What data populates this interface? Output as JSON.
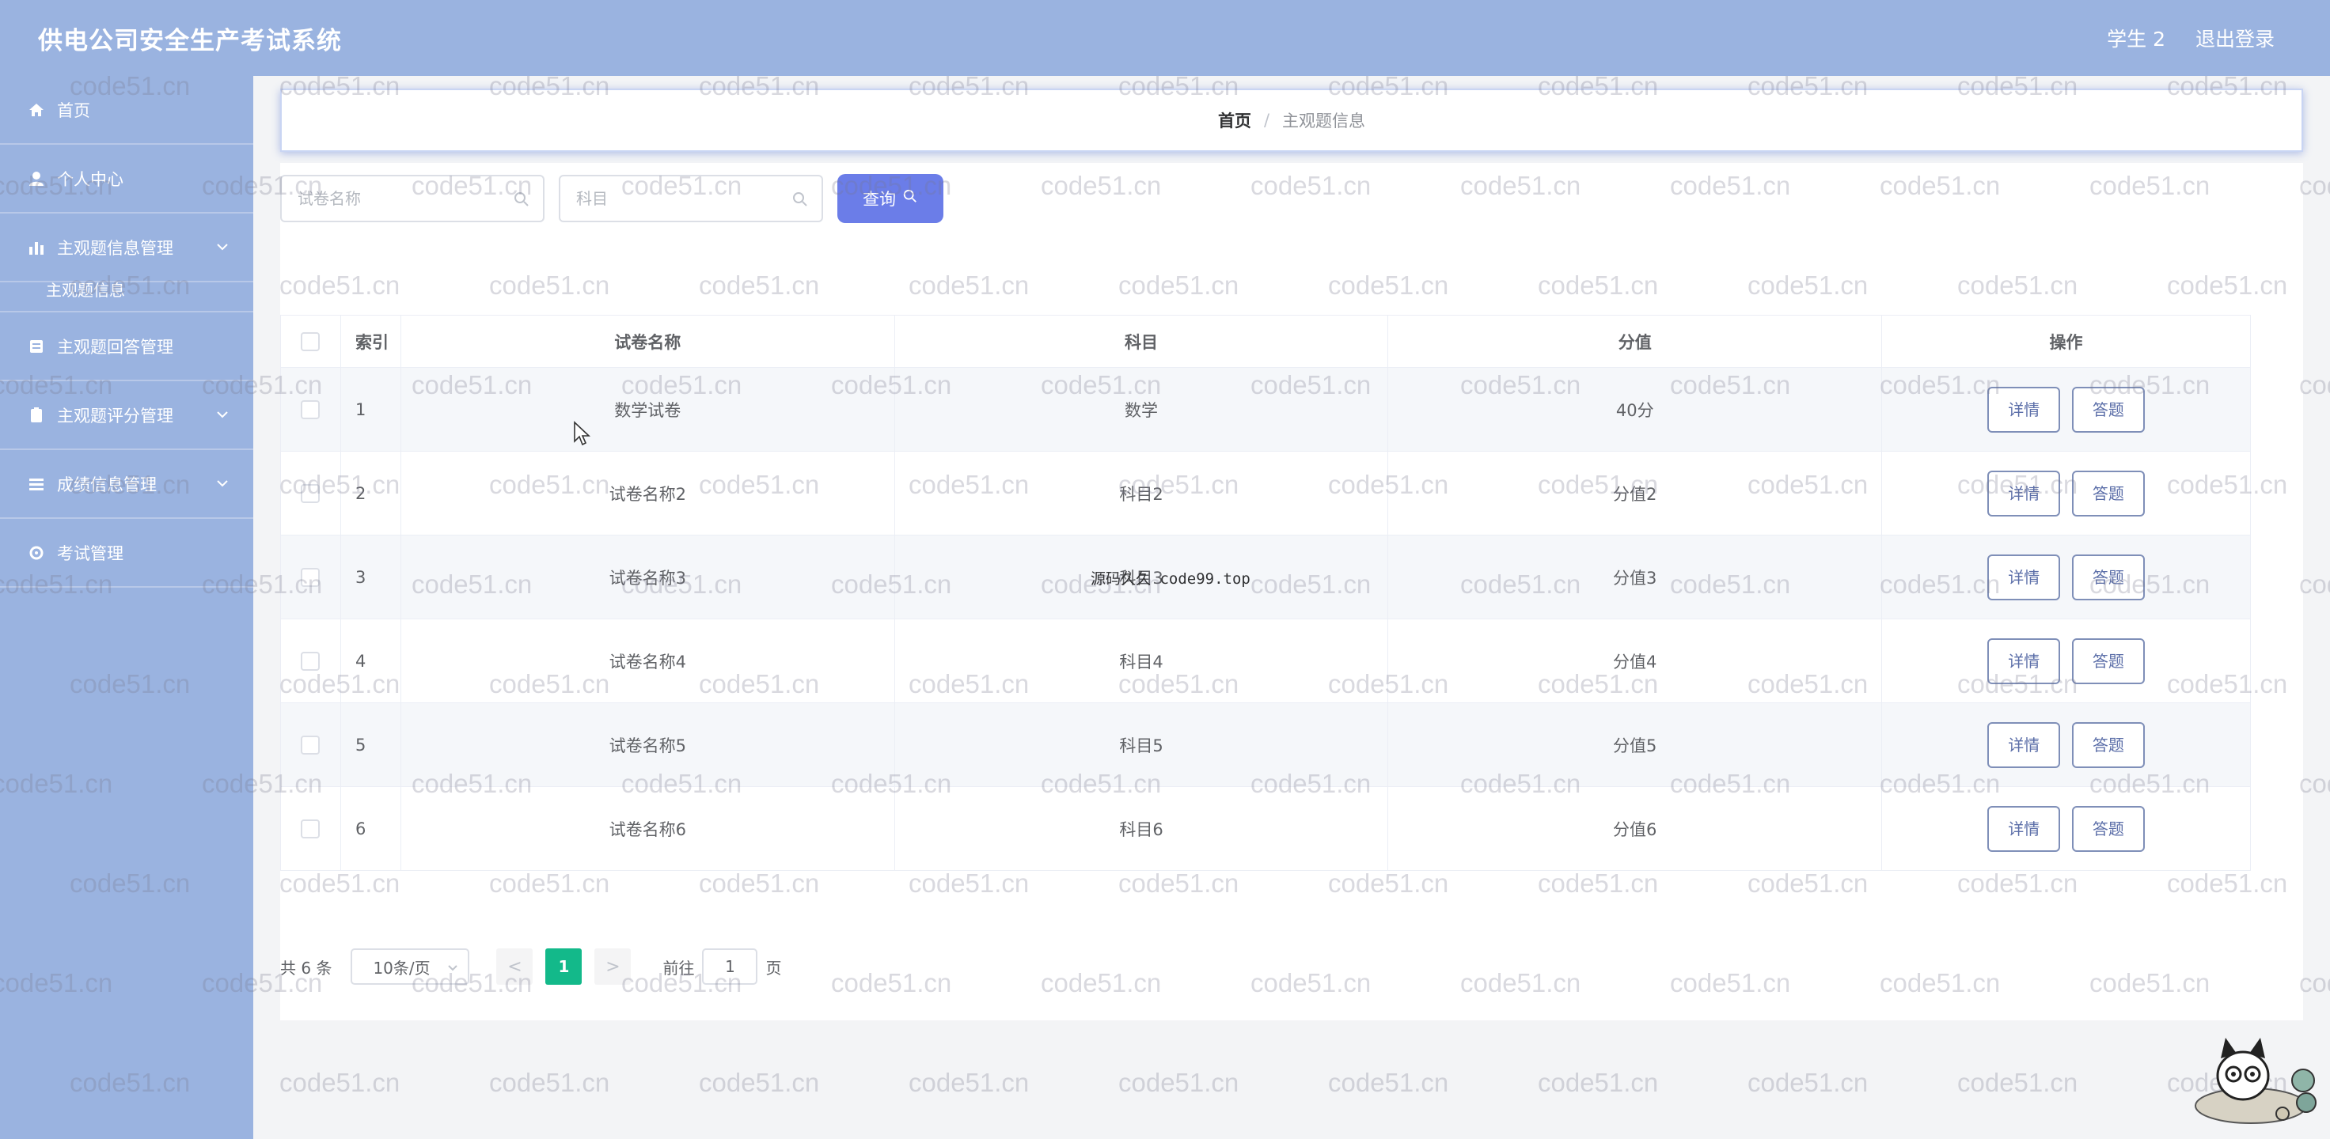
{
  "header": {
    "title": "供电公司安全生产考试系统",
    "user": "学生 2",
    "logout": "退出登录"
  },
  "sidebar": {
    "items": [
      {
        "label": "首页",
        "icon": "home-icon"
      },
      {
        "label": "个人中心",
        "icon": "user-icon"
      },
      {
        "label": "主观题信息管理",
        "icon": "bar-chart-icon"
      },
      {
        "label": "主观题回答管理",
        "icon": "document-icon"
      },
      {
        "label": "主观题评分管理",
        "icon": "clipboard-icon"
      },
      {
        "label": "成绩信息管理",
        "icon": "menu-icon"
      },
      {
        "label": "考试管理",
        "icon": "settings-icon"
      }
    ],
    "sub_item": "主观题信息"
  },
  "breadcrumb": {
    "home": "首页",
    "separator": "/",
    "current": "主观题信息"
  },
  "search": {
    "paper_placeholder": "试卷名称",
    "subject_placeholder": "科目",
    "query_label": "查询"
  },
  "table": {
    "headers": {
      "index": "索引",
      "name": "试卷名称",
      "subject": "科目",
      "score": "分值",
      "ops": "操作"
    },
    "rows": [
      {
        "index": "1",
        "name": "数学试卷",
        "subject": "数学",
        "score": "40分"
      },
      {
        "index": "2",
        "name": "试卷名称2",
        "subject": "科目2",
        "score": "分值2"
      },
      {
        "index": "3",
        "name": "试卷名称3",
        "subject": "科目3",
        "score": "分值3"
      },
      {
        "index": "4",
        "name": "试卷名称4",
        "subject": "科目4",
        "score": "分值4"
      },
      {
        "index": "5",
        "name": "试卷名称5",
        "subject": "科目5",
        "score": "分值5"
      },
      {
        "index": "6",
        "name": "试卷名称6",
        "subject": "科目6",
        "score": "分值6"
      }
    ],
    "detail_label": "详情",
    "answer_label": "答题"
  },
  "pagination": {
    "total": "共 6 条",
    "page_size": "10条/页",
    "prev": "<",
    "current_page": "1",
    "next": ">",
    "goto_label": "前往",
    "goto_value": "1",
    "page_suffix": "页"
  },
  "watermark": "code51.cn",
  "overlay_text": "源码久久 code99.top",
  "colors": {
    "header_bg": "#9ab3e0",
    "primary_button": "#6b7de8",
    "active_page": "#13b98a"
  }
}
